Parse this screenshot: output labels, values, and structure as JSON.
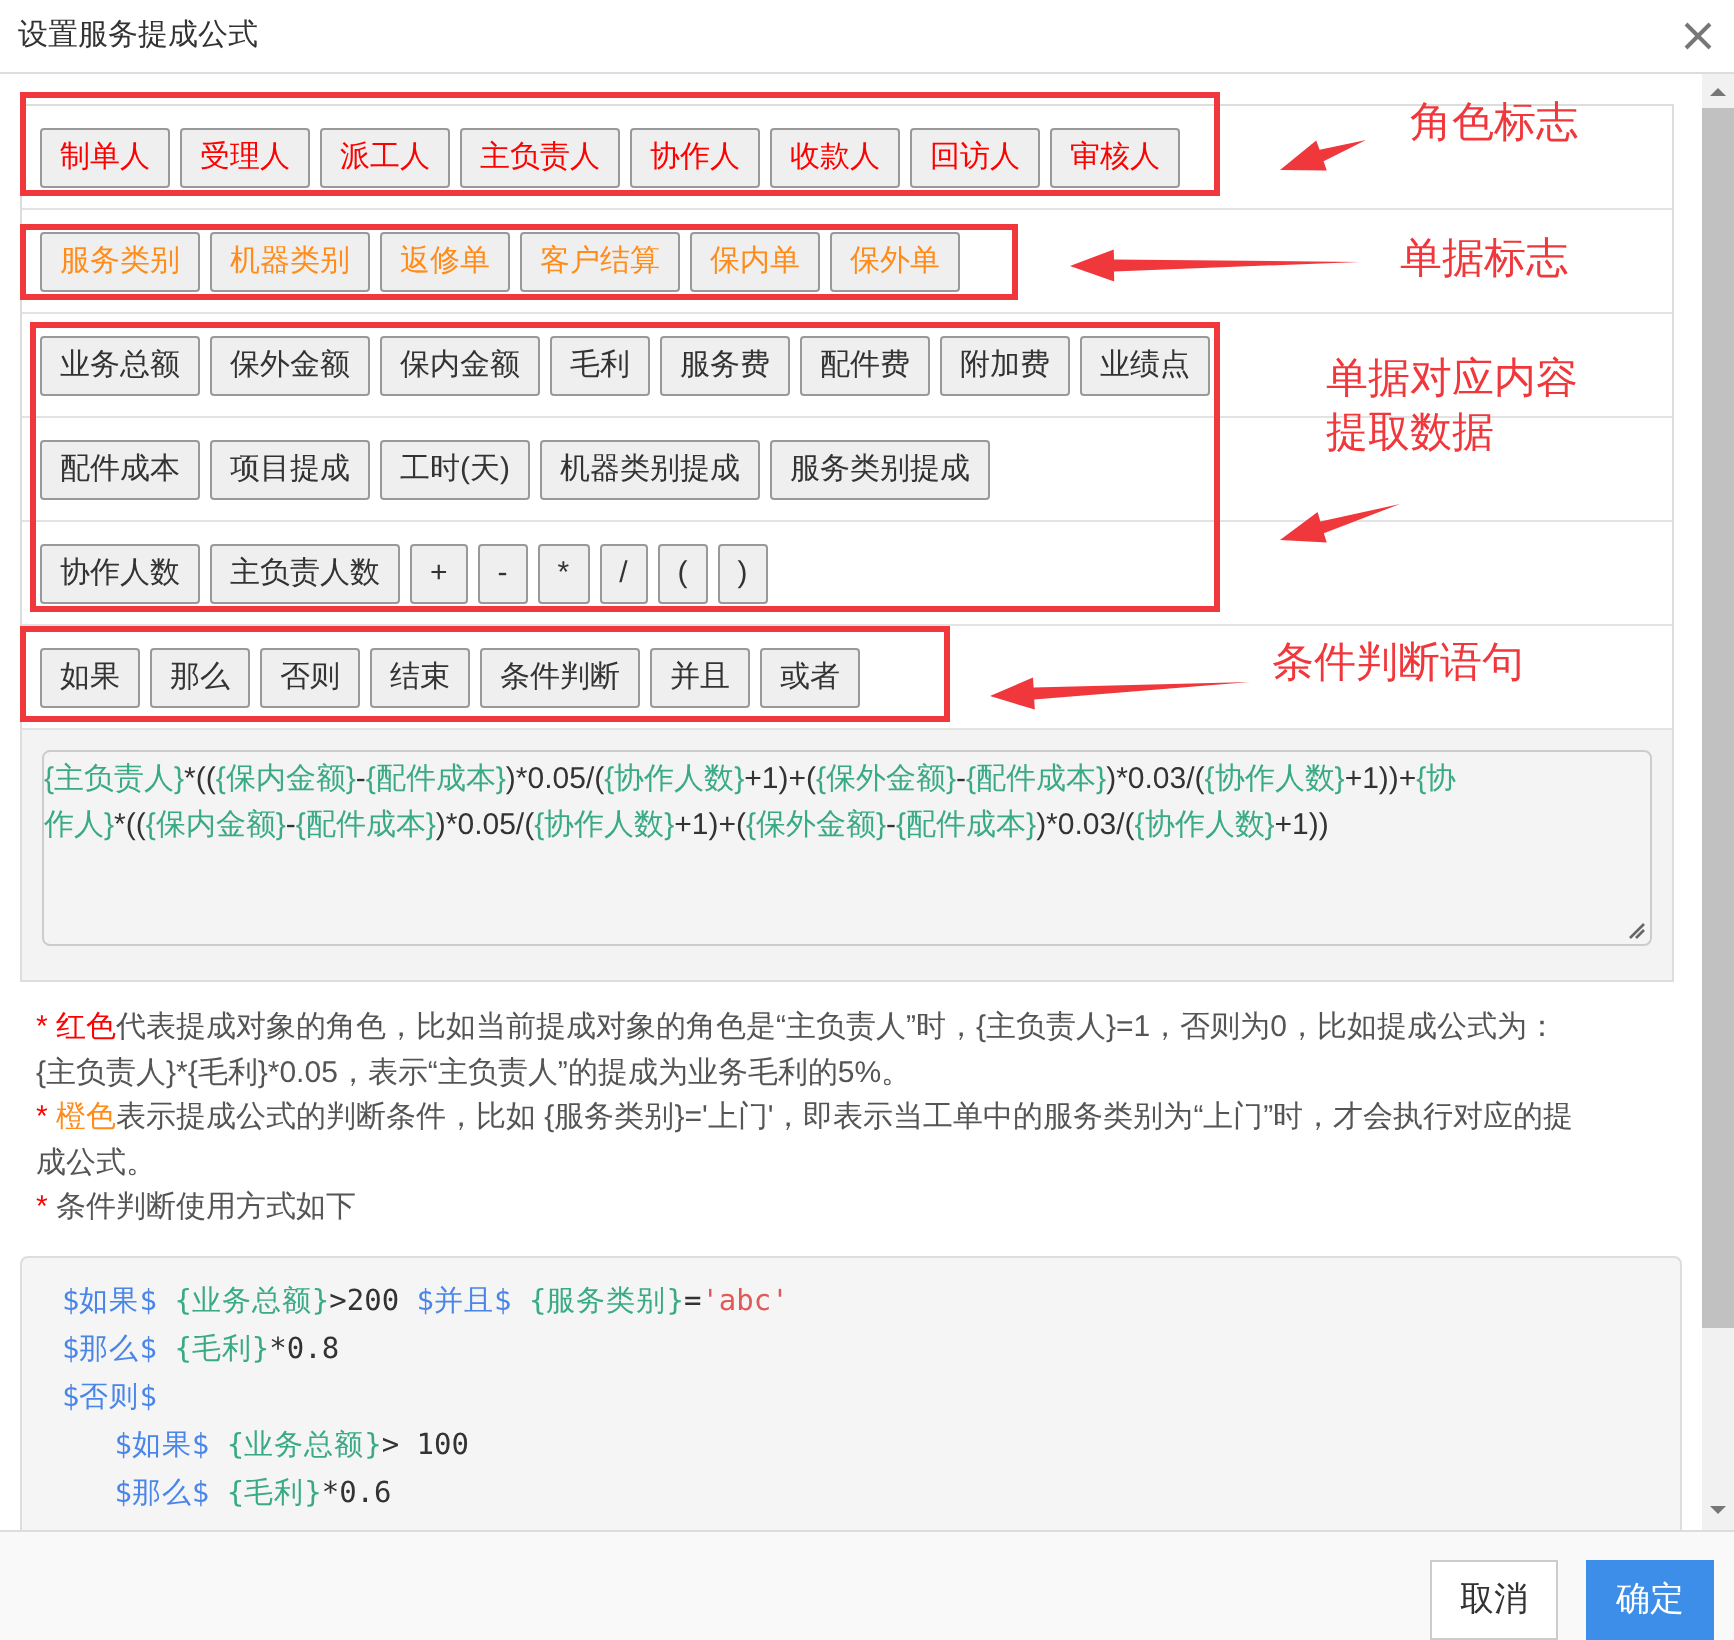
{
  "dialog": {
    "title": "设置服务提成公式"
  },
  "groups": [
    {
      "kind": "role",
      "annotation": [
        "角色标志"
      ],
      "rows": [
        {
          "buttons": [
            "制单人",
            "受理人",
            "派工人",
            "主负责人",
            "协作人",
            "收款人",
            "回访人",
            "审核人"
          ]
        }
      ]
    },
    {
      "kind": "doc",
      "annotation": [
        "单据标志"
      ],
      "rows": [
        {
          "buttons": [
            "服务类别",
            "机器类别",
            "返修单",
            "客户结算",
            "保内单",
            "保外单"
          ]
        }
      ]
    },
    {
      "kind": "data",
      "annotation": [
        "单据对应内容",
        "提取数据"
      ],
      "rows": [
        {
          "buttons": [
            "业务总额",
            "保外金额",
            "保内金额",
            "毛利",
            "服务费",
            "配件费",
            "附加费",
            "业绩点"
          ]
        },
        {
          "buttons": [
            "配件成本",
            "项目提成",
            "工时(天)",
            "机器类别提成",
            "服务类别提成"
          ]
        },
        {
          "buttons": [
            "协作人数",
            "主负责人数",
            "+",
            "-",
            "*",
            "/",
            "(",
            ")"
          ]
        }
      ]
    },
    {
      "kind": "condition",
      "annotation": [
        "条件判断语句"
      ],
      "rows": [
        {
          "buttons": [
            "如果",
            "那么",
            "否则",
            "结束",
            "条件判断",
            "并且",
            "或者"
          ]
        }
      ]
    }
  ],
  "formula": [
    {
      "kind": "field",
      "text": "{主负责人}"
    },
    {
      "kind": "op",
      "text": "*(("
    },
    {
      "kind": "field",
      "text": "{保内金额}"
    },
    {
      "kind": "op",
      "text": "-"
    },
    {
      "kind": "field",
      "text": "{配件成本}"
    },
    {
      "kind": "op",
      "text": ")*0.05/("
    },
    {
      "kind": "field",
      "text": "{协作人数}"
    },
    {
      "kind": "op",
      "text": "+1)+("
    },
    {
      "kind": "field",
      "text": "{保外金额}"
    },
    {
      "kind": "op",
      "text": "-"
    },
    {
      "kind": "field",
      "text": "{配件成本}"
    },
    {
      "kind": "op",
      "text": ")*0.03/("
    },
    {
      "kind": "field",
      "text": "{协作人数}"
    },
    {
      "kind": "op",
      "text": "+1))+"
    },
    {
      "kind": "field",
      "text": "{协作人}"
    },
    {
      "kind": "op",
      "text": "*(("
    },
    {
      "kind": "field",
      "text": "{保内金额}"
    },
    {
      "kind": "op",
      "text": "-"
    },
    {
      "kind": "field",
      "text": "{配件成本}"
    },
    {
      "kind": "op",
      "text": ")*0.05/("
    },
    {
      "kind": "field",
      "text": "{协作人数}"
    },
    {
      "kind": "op",
      "text": "+1)+("
    },
    {
      "kind": "field",
      "text": "{保外金额}"
    },
    {
      "kind": "op",
      "text": "-"
    },
    {
      "kind": "field",
      "text": "{配件成本}"
    },
    {
      "kind": "op",
      "text": ")*0.03/("
    },
    {
      "kind": "field",
      "text": "{协作人数}"
    },
    {
      "kind": "op",
      "text": "+1))"
    }
  ],
  "notes": [
    {
      "marker": "*",
      "highlight": {
        "text": "红色",
        "color": "#ff0000"
      },
      "text": "代表提成对象的角色，比如当前提成对象的角色是“主负责人”时，{主负责人}=1，否则为0，比如提成公式为：{主负责人}*{毛利}*0.05，表示“主负责人”的提成为业务毛利的5%。"
    },
    {
      "marker": "*",
      "highlight": {
        "text": "橙色",
        "color": "#ff8c1a"
      },
      "text": "表示提成公式的判断条件，比如 {服务类别}='上门'，即表示当工单中的服务类别为“上门”时，才会执行对应的提成公式。"
    },
    {
      "marker": "*",
      "text": "条件判断使用方式如下"
    }
  ],
  "code": [
    {
      "children": [
        {
          "kind": "keyword",
          "text": "$如果$"
        },
        {
          "kind": "field",
          "text": "{业务总额}",
          "spaced": true
        },
        {
          "kind": "plain",
          "text": ">200"
        },
        {
          "kind": "keyword",
          "text": "$并且$",
          "spaced": true
        },
        {
          "kind": "field",
          "text": "{服务类别}",
          "spaced": true
        },
        {
          "kind": "plain",
          "text": "="
        },
        {
          "kind": "string",
          "text": "'abc'"
        }
      ]
    },
    {
      "children": [
        {
          "kind": "keyword",
          "text": "$那么$"
        },
        {
          "kind": "field",
          "text": "{毛利}",
          "spaced": true
        },
        {
          "kind": "plain",
          "text": "*0.8"
        }
      ]
    },
    {
      "children": [
        {
          "kind": "keyword",
          "text": "$否则$"
        }
      ],
      "lines": [
        {
          "children": [
            {
              "kind": "keyword",
              "text": "$如果$"
            },
            {
              "kind": "field",
              "text": "{业务总额}",
              "spaced": true
            },
            {
              "kind": "plain",
              "text": "> 100"
            }
          ]
        },
        {
          "children": [
            {
              "kind": "keyword",
              "text": "$那么$"
            },
            {
              "kind": "field",
              "text": "{毛利}",
              "spaced": true
            },
            {
              "kind": "plain",
              "text": "*0.6"
            }
          ]
        }
      ]
    }
  ],
  "buttons": [
    {
      "label": "取消",
      "kind": "secondary"
    },
    {
      "label": "确定",
      "kind": "primary"
    }
  ]
}
